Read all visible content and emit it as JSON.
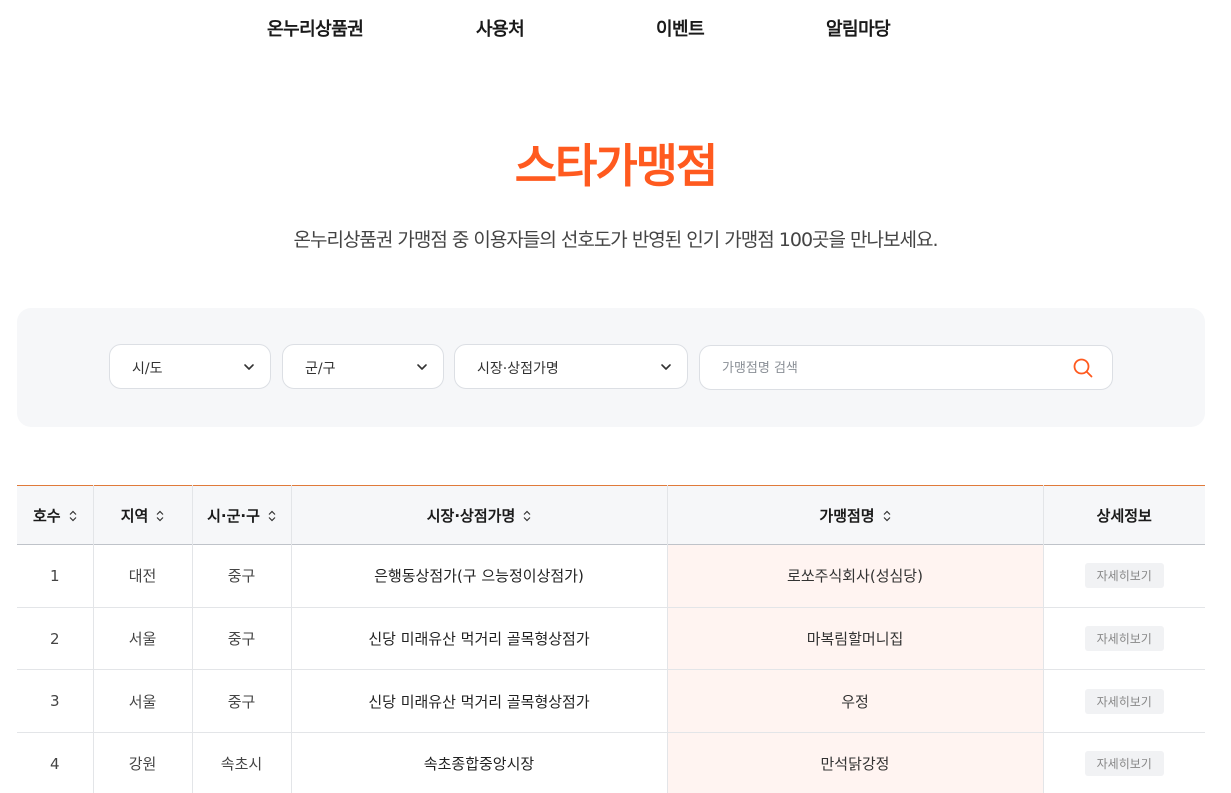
{
  "nav": {
    "items": [
      "온누리상품권",
      "사용처",
      "이벤트",
      "알림마당"
    ]
  },
  "page": {
    "title": "스타가맹점",
    "description": "온누리상품권 가맹점 중 이용자들의 선호도가 반영된 인기 가맹점 100곳을 만나보세요."
  },
  "filters": {
    "sido": "시/도",
    "gungu": "군/구",
    "market": "시장·상점가명",
    "search_placeholder": "가맹점명 검색"
  },
  "table": {
    "headers": [
      "호수",
      "지역",
      "시·군·구",
      "시장·상점가명",
      "가맹점명",
      "상세정보"
    ],
    "detail_label": "자세히보기",
    "rows": [
      {
        "no": "1",
        "region": "대전",
        "district": "중구",
        "market": "은행동상점가(구 으능정이상점가)",
        "store": "로쏘주식회사(성심당)"
      },
      {
        "no": "2",
        "region": "서울",
        "district": "중구",
        "market": "신당 미래유산 먹거리 골목형상점가",
        "store": "마복림할머니집"
      },
      {
        "no": "3",
        "region": "서울",
        "district": "중구",
        "market": "신당 미래유산 먹거리 골목형상점가",
        "store": "우정"
      },
      {
        "no": "4",
        "region": "강원",
        "district": "속초시",
        "market": "속초종합중앙시장",
        "store": "만석닭강정"
      }
    ]
  },
  "colors": {
    "accent": "#ff5a1f",
    "store_column_bg": "#fff4f1",
    "panel_bg": "#f6f7f9"
  }
}
